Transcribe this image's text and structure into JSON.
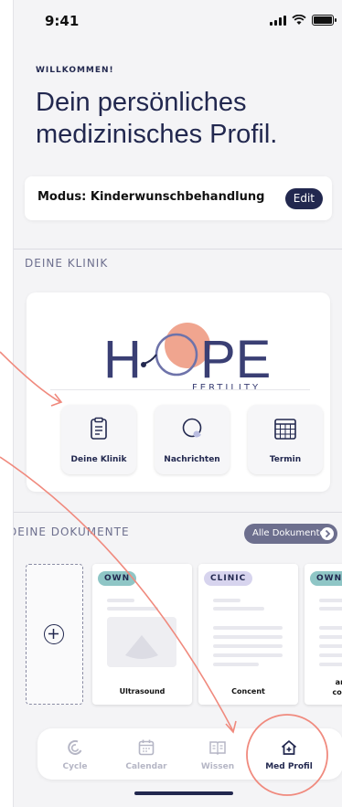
{
  "status_bar": {
    "time": "9:41"
  },
  "welcome": {
    "eyebrow": "WILLKOMMEN!",
    "headline": "Dein persönliches medizinisches Profil."
  },
  "mode": {
    "label": "Modus: Kinderwunschbehandlung",
    "edit_label": "Edit"
  },
  "clinic_section": {
    "title": "DEINE KLINIK",
    "logo_word_start": "H",
    "logo_word_end": "PE",
    "logo_sub": "FERTILITY",
    "tiles": [
      {
        "label": "Deine Klinik",
        "icon": "clipboard-icon"
      },
      {
        "label": "Nachrichten",
        "icon": "chat-bubble-icon"
      },
      {
        "label": "Termin",
        "icon": "calendar-grid-icon"
      }
    ]
  },
  "documents_section": {
    "title": "DEINE DOKUMENTE",
    "all_label": "Alle Dokumente",
    "add_icon": "plus-circle-icon",
    "documents": [
      {
        "tag": "OWN",
        "caption": "Ultrasound"
      },
      {
        "tag": "CLINIC",
        "caption": "Concent"
      },
      {
        "tag": "OWN",
        "caption_line1": "amet-sit",
        "caption_line2": "consectet"
      }
    ]
  },
  "bottom_nav": {
    "items": [
      {
        "label": "Cycle",
        "icon": "cycle-icon"
      },
      {
        "label": "Calendar",
        "icon": "calendar-icon"
      },
      {
        "label": "Wissen",
        "icon": "book-icon"
      },
      {
        "label": "Med Profil",
        "icon": "home-plus-icon",
        "active": true
      }
    ]
  },
  "colors": {
    "primary": "#22284f",
    "accent_salmon": "#f08a7e",
    "muted": "#6d6f8e",
    "tag_own": "#8fc6c6",
    "tag_clinic": "#d7d4ee"
  }
}
